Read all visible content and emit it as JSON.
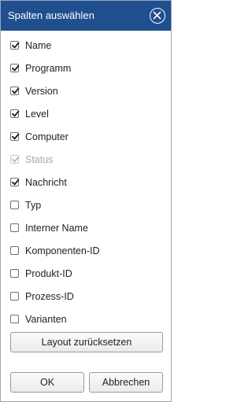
{
  "dialog": {
    "title": "Spalten auswählen",
    "close_icon": "close-circle-icon",
    "header_color": "#1f4f8f"
  },
  "options": [
    {
      "key": "name",
      "label": "Name",
      "checked": true,
      "disabled": false
    },
    {
      "key": "programm",
      "label": "Programm",
      "checked": true,
      "disabled": false
    },
    {
      "key": "version",
      "label": "Version",
      "checked": true,
      "disabled": false
    },
    {
      "key": "level",
      "label": "Level",
      "checked": true,
      "disabled": false
    },
    {
      "key": "computer",
      "label": "Computer",
      "checked": true,
      "disabled": false
    },
    {
      "key": "status",
      "label": "Status",
      "checked": true,
      "disabled": true
    },
    {
      "key": "nachricht",
      "label": "Nachricht",
      "checked": true,
      "disabled": false
    },
    {
      "key": "typ",
      "label": "Typ",
      "checked": false,
      "disabled": false
    },
    {
      "key": "interner-name",
      "label": "Interner Name",
      "checked": false,
      "disabled": false
    },
    {
      "key": "komponenten-id",
      "label": "Komponenten-ID",
      "checked": false,
      "disabled": false
    },
    {
      "key": "produkt-id",
      "label": "Produkt-ID",
      "checked": false,
      "disabled": false
    },
    {
      "key": "prozess-id",
      "label": "Prozess-ID",
      "checked": false,
      "disabled": false
    },
    {
      "key": "varianten",
      "label": "Varianten",
      "checked": false,
      "disabled": false
    }
  ],
  "buttons": {
    "reset_label": "Layout zurücksetzen",
    "ok_label": "OK",
    "cancel_label": "Abbrechen"
  }
}
